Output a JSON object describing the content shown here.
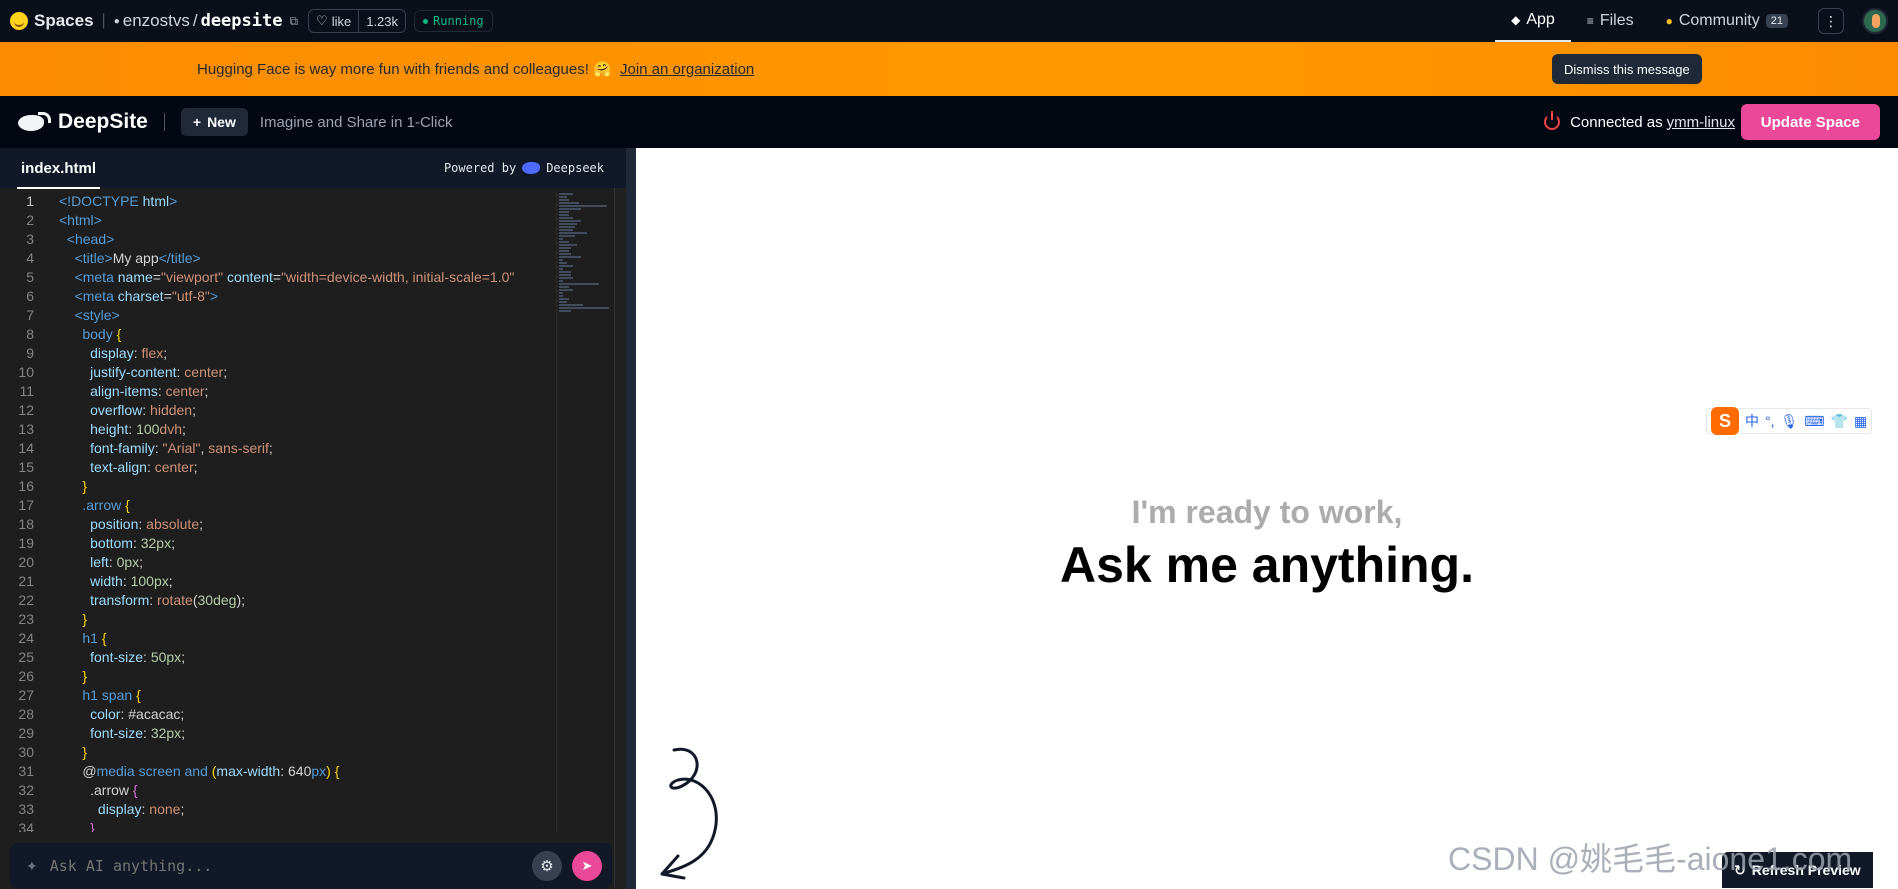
{
  "hf_header": {
    "brand": "Spaces",
    "owner": "enzostvs",
    "repo": "deepsite",
    "like_label": "like",
    "like_count": "1.23k",
    "status": "Running",
    "tabs": [
      {
        "label": "App",
        "icon": "app-icon"
      },
      {
        "label": "Files",
        "icon": "files-icon"
      },
      {
        "label": "Community",
        "icon": "community-icon",
        "badge": "21"
      }
    ]
  },
  "banner": {
    "message": "Hugging Face is way more fun with friends and colleagues! 🤗",
    "join_link": "Join an organization",
    "dismiss_label": "Dismiss this message"
  },
  "deepsite": {
    "title": "DeepSite",
    "new_label": "New",
    "tagline": "Imagine and Share in 1-Click",
    "connected_prefix": "Connected as",
    "username": "ymm-linux",
    "update_label": "Update Space"
  },
  "editor": {
    "filename": "index.html",
    "powered_by": "Powered by",
    "powered_brand": "Deepseek",
    "ask_placeholder": "Ask AI anything..."
  },
  "preview": {
    "subtitle": "I'm ready to work,",
    "headline": "Ask me anything.",
    "refresh_label": "Refresh Preview",
    "ime_char": "中"
  },
  "watermark": "CSDN @姚毛毛-aione1.com",
  "colors": {
    "accent_pink": "#ec4899",
    "banner_orange": "#fb8c00",
    "running_green": "#10b981"
  }
}
